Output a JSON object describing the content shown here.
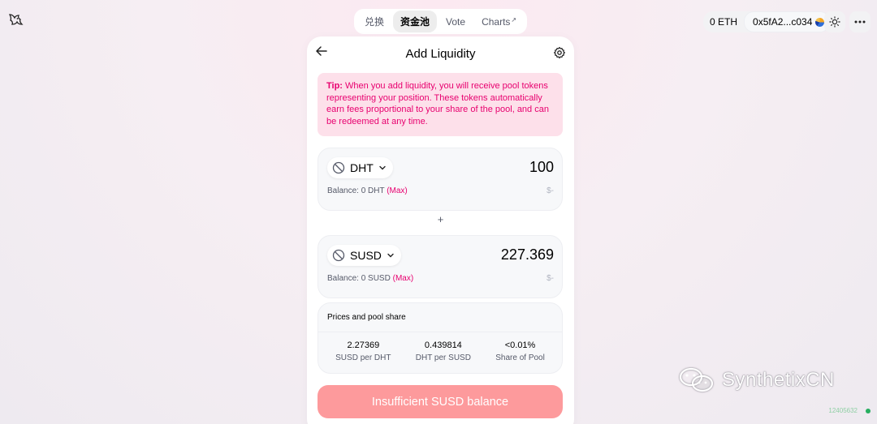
{
  "nav": {
    "tabs": [
      {
        "label": "兑换"
      },
      {
        "label": "资金池"
      },
      {
        "label": "Vote"
      },
      {
        "label": "Charts",
        "ext": "↗"
      }
    ]
  },
  "account": {
    "balance": "0 ETH",
    "address": "0x5fA2...c034"
  },
  "card": {
    "title": "Add Liquidity",
    "tip": {
      "label": "Tip:",
      "text": " When you add liquidity, you will receive pool tokens representing your position. These tokens automatically earn fees proportional to your share of the pool, and can be redeemed at any time."
    },
    "input_a": {
      "symbol": "DHT",
      "amount": "100",
      "balance": "Balance: 0 DHT",
      "max": "(Max)",
      "usd": "$-"
    },
    "plus": "+",
    "input_b": {
      "symbol": "SUSD",
      "amount": "227.369",
      "balance": "Balance: 0 SUSD",
      "max": "(Max)",
      "usd": "$-"
    },
    "prices": {
      "title": "Prices and pool share",
      "stats": [
        {
          "value": "2.27369",
          "label": "SUSD per DHT"
        },
        {
          "value": "0.439814",
          "label": "DHT per SUSD"
        },
        {
          "value": "<0.01%",
          "label": "Share of Pool"
        }
      ]
    },
    "action_label": "Insufficient SUSD balance"
  },
  "watermark": "SynthetixCN",
  "block_number": "12405632"
}
